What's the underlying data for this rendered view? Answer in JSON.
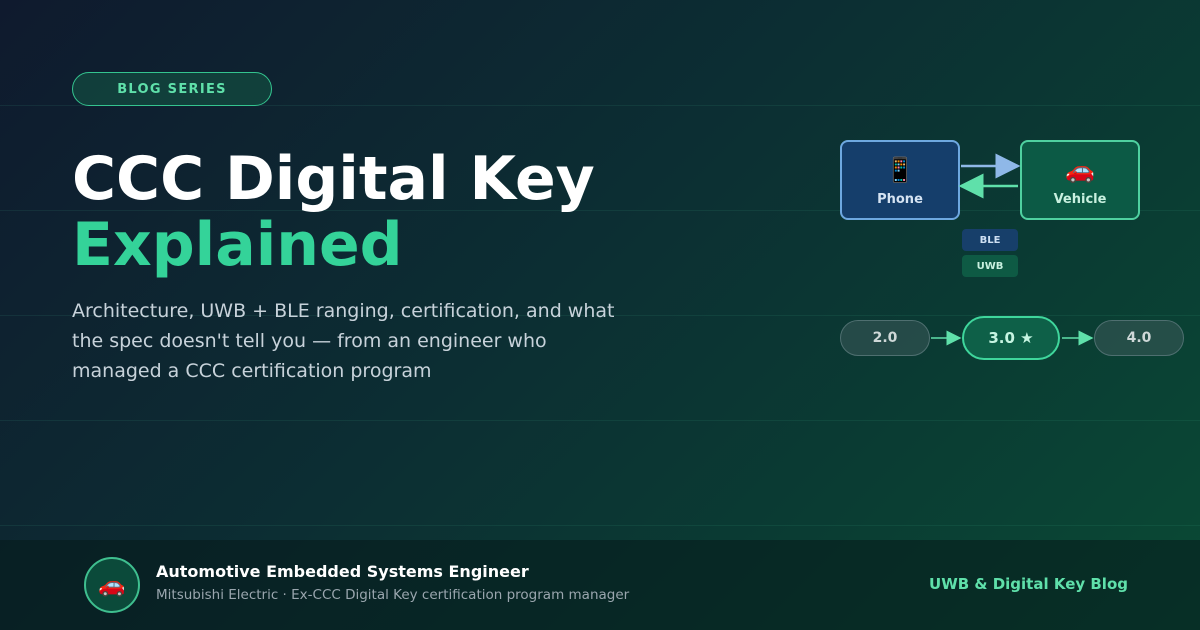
{
  "badge": {
    "label": "BLOG SERIES"
  },
  "hero": {
    "title_line1": "CCC Digital Key",
    "title_line2": "Explained",
    "subtitle": "Architecture, UWB + BLE ranging, certification, and what the spec doesn't tell you — from an engineer who managed a CCC certification program"
  },
  "diagram": {
    "phone": {
      "label": "Phone",
      "icon": "phone-icon",
      "glyph": "📱"
    },
    "vehicle": {
      "label": "Vehicle",
      "icon": "car-icon",
      "glyph": "🚗"
    },
    "protocols": [
      "BLE",
      "UWB"
    ]
  },
  "versions": [
    {
      "label": "2.0"
    },
    {
      "label": "3.0 ★"
    },
    {
      "label": "4.0"
    }
  ],
  "footer": {
    "avatar": {
      "icon": "car-icon",
      "glyph": "🚗"
    },
    "author_name": "Automotive Embedded Systems Engineer",
    "author_role": "Mitsubishi Electric · Ex-CCC Digital Key certification program manager",
    "blog_name": "UWB & Digital Key Blog"
  },
  "colors": {
    "accent_green": "#34d399",
    "phone_blue": "#153e6b",
    "vehicle_green": "#0c5a45"
  }
}
